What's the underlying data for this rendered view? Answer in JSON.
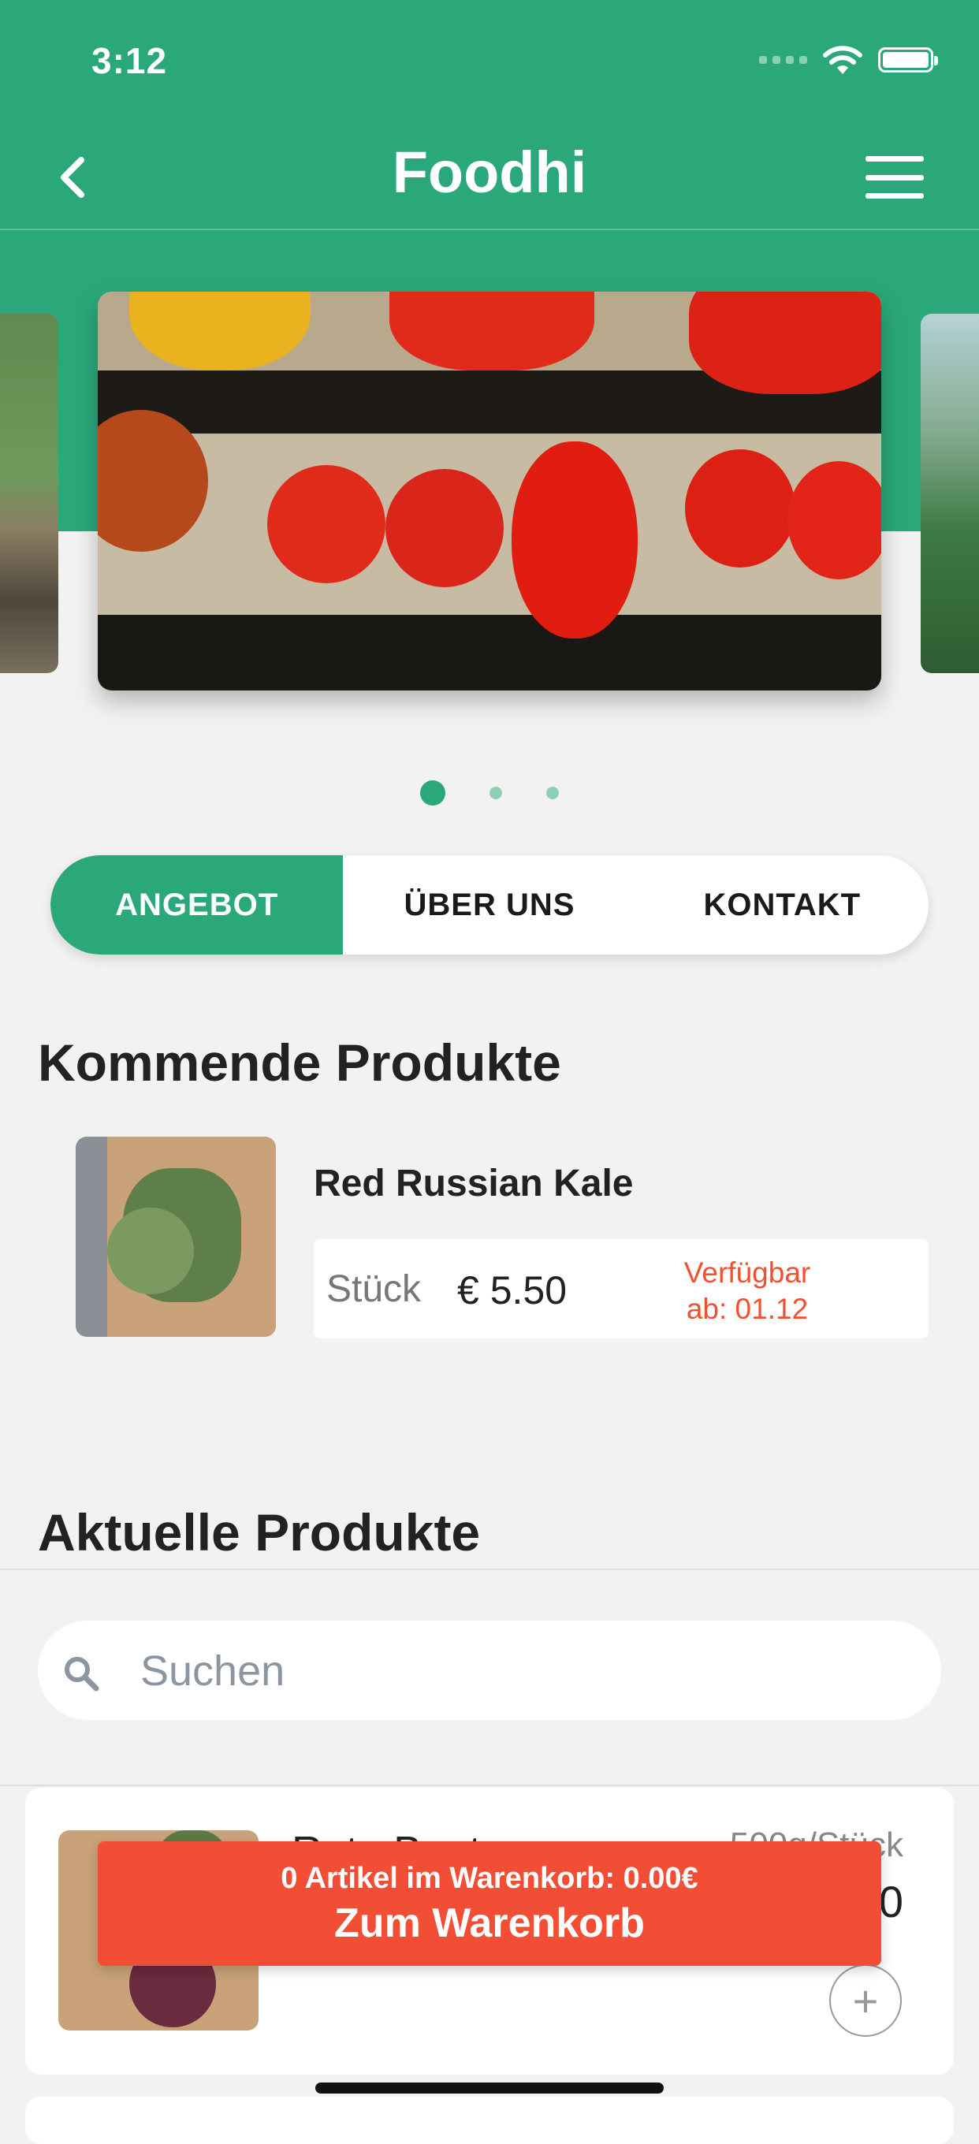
{
  "status_bar": {
    "time": "3:12"
  },
  "header": {
    "title": "Foodhi"
  },
  "carousel": {
    "slides": 3,
    "active_index": 0
  },
  "tabs": [
    {
      "label": "ANGEBOT",
      "active": true
    },
    {
      "label": "ÜBER UNS",
      "active": false
    },
    {
      "label": "KONTAKT",
      "active": false
    }
  ],
  "upcoming": {
    "title": "Kommende Produkte",
    "product": {
      "name": "Red Russian Kale",
      "unit": "Stück",
      "price": "€ 5.50",
      "availability_line1": "Verfügbar",
      "availability_line2": "ab: 01.12"
    }
  },
  "current": {
    "title": "Aktuelle Produkte",
    "search_placeholder": "Suchen",
    "product": {
      "name": "Rote Beete",
      "unit": "500g/Stück",
      "price": "€ 2.50",
      "add_label": "+"
    }
  },
  "cart": {
    "summary": "0 Artikel im Warenkorb: 0.00€",
    "button_label": "Zum Warenkorb"
  },
  "colors": {
    "primary": "#2aa87a",
    "accent": "#f14e35",
    "background": "#f2f2f2"
  }
}
